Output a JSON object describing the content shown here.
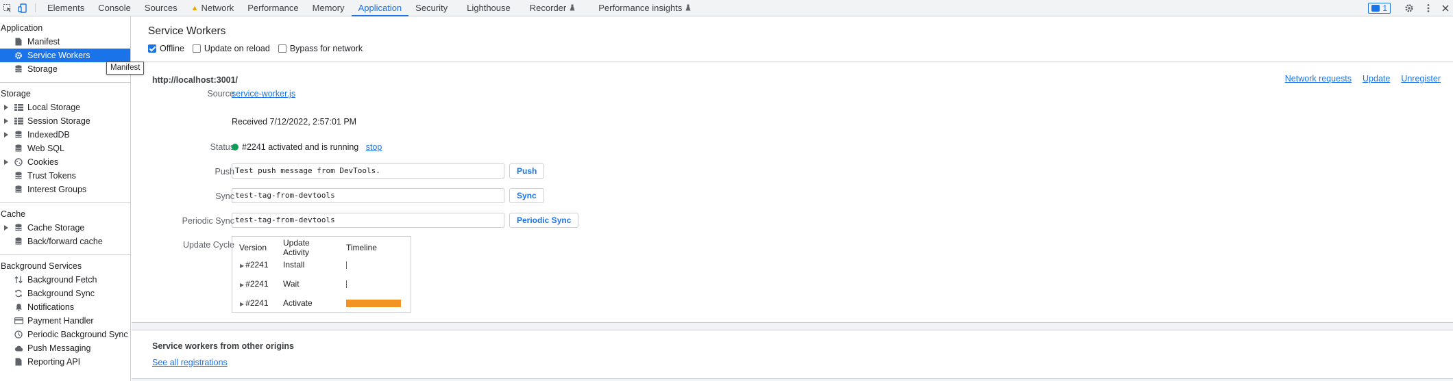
{
  "toolbar": {
    "tabs": [
      {
        "label": "Elements"
      },
      {
        "label": "Console"
      },
      {
        "label": "Sources"
      },
      {
        "label": "Network"
      },
      {
        "label": "Performance"
      },
      {
        "label": "Memory"
      },
      {
        "label": "Application"
      },
      {
        "label": "Security"
      },
      {
        "label": "Lighthouse"
      },
      {
        "label": "Recorder"
      },
      {
        "label": "Performance insights"
      }
    ],
    "active_tab": "Application",
    "issues_count": "1"
  },
  "sidebar": {
    "application": {
      "title": "Application",
      "items": [
        {
          "label": "Manifest"
        },
        {
          "label": "Service Workers"
        },
        {
          "label": "Storage"
        }
      ]
    },
    "storage": {
      "title": "Storage",
      "items": [
        {
          "label": "Local Storage"
        },
        {
          "label": "Session Storage"
        },
        {
          "label": "IndexedDB"
        },
        {
          "label": "Web SQL"
        },
        {
          "label": "Cookies"
        },
        {
          "label": "Trust Tokens"
        },
        {
          "label": "Interest Groups"
        }
      ]
    },
    "cache": {
      "title": "Cache",
      "items": [
        {
          "label": "Cache Storage"
        },
        {
          "label": "Back/forward cache"
        }
      ]
    },
    "background": {
      "title": "Background Services",
      "items": [
        {
          "label": "Background Fetch"
        },
        {
          "label": "Background Sync"
        },
        {
          "label": "Notifications"
        },
        {
          "label": "Payment Handler"
        },
        {
          "label": "Periodic Background Sync"
        },
        {
          "label": "Push Messaging"
        },
        {
          "label": "Reporting API"
        }
      ]
    },
    "tooltip": "Manifest"
  },
  "panel": {
    "title": "Service Workers",
    "options": {
      "offline": "Offline",
      "update_on_reload": "Update on reload",
      "bypass_for_network": "Bypass for network"
    },
    "origin": "http://localhost:3001/",
    "links": {
      "network_requests": "Network requests",
      "update": "Update",
      "unregister": "Unregister"
    },
    "source": {
      "label": "Source",
      "file": "service-worker.js",
      "received": "Received 7/12/2022, 2:57:01 PM"
    },
    "status": {
      "label": "Status",
      "text": "#2241 activated and is running",
      "stop": "stop",
      "color": "#0d9d58"
    },
    "push": {
      "label": "Push",
      "value": "Test push message from DevTools.",
      "button": "Push"
    },
    "sync": {
      "label": "Sync",
      "value": "test-tag-from-devtools",
      "button": "Sync"
    },
    "periodic_sync": {
      "label": "Periodic Sync",
      "value": "test-tag-from-devtools",
      "button": "Periodic Sync"
    },
    "update_cycle": {
      "label": "Update Cycle",
      "headers": {
        "version": "Version",
        "activity": "Update Activity",
        "timeline": "Timeline"
      },
      "rows": [
        {
          "version": "#2241",
          "activity": "Install",
          "color": "#0d9d58"
        },
        {
          "version": "#2241",
          "activity": "Wait",
          "color": "#d01884"
        },
        {
          "version": "#2241",
          "activity": "Activate",
          "color": "#f29423"
        }
      ]
    },
    "other_origins": {
      "title": "Service workers from other origins",
      "link": "See all registrations"
    }
  }
}
